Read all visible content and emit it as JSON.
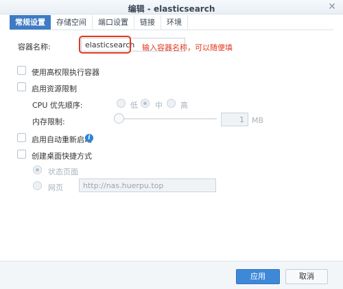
{
  "window": {
    "title": "编辑 - elasticsearch",
    "close_icon": "close-icon"
  },
  "tabs": [
    {
      "label": "常规设置",
      "active": true
    },
    {
      "label": "存储空间",
      "active": false
    },
    {
      "label": "端口设置",
      "active": false
    },
    {
      "label": "链接",
      "active": false
    },
    {
      "label": "环境",
      "active": false
    }
  ],
  "container_name": {
    "label": "容器名称:",
    "value": "elasticsearch",
    "annotation": "输入容器名称，可以随便填"
  },
  "options": {
    "high_privilege": "使用高权限执行容器",
    "resource_limit": "启用资源限制",
    "cpu_priority_label": "CPU 优先顺序:",
    "cpu_options": [
      "低",
      "中",
      "高"
    ],
    "cpu_selected": "中",
    "memory_limit_label": "内存限制:",
    "memory_value": "1",
    "memory_unit": "MB",
    "auto_restart": "启用自动重新启动",
    "desktop_shortcut": "创建桌面快捷方式",
    "shortcut_status_page": "状态页面",
    "shortcut_webpage": "网页",
    "webpage_url": "http://nas.huerpu.top"
  },
  "footer": {
    "apply_label": "应用",
    "cancel_label": "取消"
  },
  "colors": {
    "accent": "#3e7bc4",
    "annotation_red": "#e0371a"
  }
}
